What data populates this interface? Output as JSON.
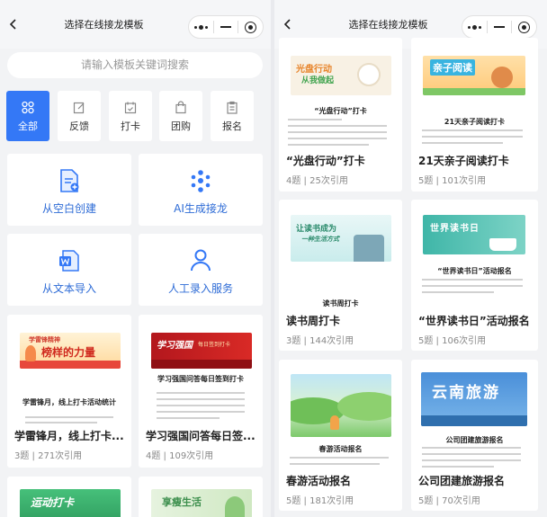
{
  "left": {
    "nav_title": "选择在线接龙模板",
    "search_placeholder": "请输入模板关键词搜索",
    "categories": [
      {
        "label": "全部",
        "icon": "grid-icon",
        "active": true
      },
      {
        "label": "反馈",
        "icon": "edit-icon"
      },
      {
        "label": "打卡",
        "icon": "calendar-check-icon"
      },
      {
        "label": "团购",
        "icon": "bag-icon"
      },
      {
        "label": "报名",
        "icon": "clipboard-icon"
      }
    ],
    "actions": [
      {
        "label": "从空白创建",
        "icon": "blank-doc-icon"
      },
      {
        "label": "AI生成接龙",
        "icon": "ai-icon"
      },
      {
        "label": "从文本导入",
        "icon": "word-icon"
      },
      {
        "label": "人工录入服务",
        "icon": "person-icon"
      }
    ],
    "templates": [
      {
        "title": "学雷锋月，线上打卡...",
        "caption": "学雷锋月，线上打卡活动统计",
        "banner": "榜样的力量",
        "banner_sub": "学雷锋精神",
        "meta": "3题 | 271次引用"
      },
      {
        "title": "学习强国问答每日签...",
        "caption": "学习强国问答每日签到打卡",
        "banner": "学习强国",
        "banner_sub": "每日签到打卡",
        "meta": "4题 | 109次引用"
      },
      {
        "banner": "运动打卡"
      },
      {
        "banner": "享瘦生活"
      }
    ]
  },
  "right": {
    "nav_title": "选择在线接龙模板",
    "templates": [
      {
        "title": "“光盘行动”打卡",
        "caption": "“光盘行动”打卡",
        "banner": "光盘行动",
        "banner_sub": "从我做起",
        "meta": "4题 | 25次引用"
      },
      {
        "title": "21天亲子阅读打卡",
        "caption": "21天亲子阅读打卡",
        "banner": "亲子阅读",
        "meta": "5题 | 101次引用"
      },
      {
        "title": "读书周打卡",
        "caption": "读书周打卡",
        "banner": "让读书成为",
        "banner_sub": "一种生活方式",
        "meta": "3题 | 144次引用"
      },
      {
        "title": "“世界读书日”活动报名",
        "caption": "“世界读书日”活动报名",
        "banner": "世界读书日",
        "meta": "5题 | 106次引用"
      },
      {
        "title": "春游活动报名",
        "caption": "春游活动报名",
        "meta": "5题 | 181次引用"
      },
      {
        "title": "公司团建旅游报名",
        "caption": "公司团建旅游报名",
        "banner": "云南旅游",
        "meta": "5题 | 70次引用"
      }
    ]
  },
  "colors": {
    "accent": "#3478f6",
    "action_text": "#2d6bd6"
  }
}
